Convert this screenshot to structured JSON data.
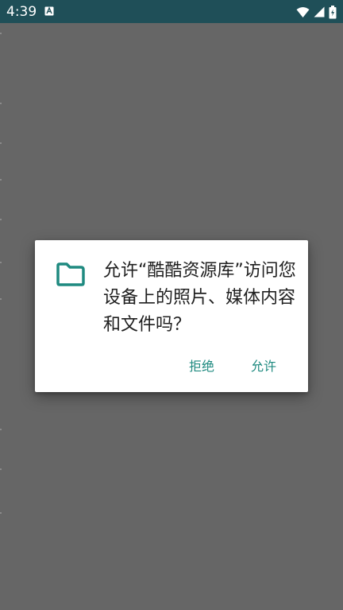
{
  "status_bar": {
    "time": "4:39",
    "app_icon": "a-notification-icon",
    "icons": [
      "wifi-icon",
      "signal-icon",
      "battery-icon"
    ]
  },
  "dialog": {
    "icon": "folder-icon",
    "message": "允许“酷酷资源库”访问您设备上的照片、媒体内容和文件吗？",
    "buttons": {
      "deny": "拒绝",
      "allow": "允许"
    }
  },
  "colors": {
    "status_bar": "#1f4f58",
    "scrim": "#666666",
    "dialog": "#ffffff",
    "accent": "#1f8a80",
    "text": "#202020"
  }
}
